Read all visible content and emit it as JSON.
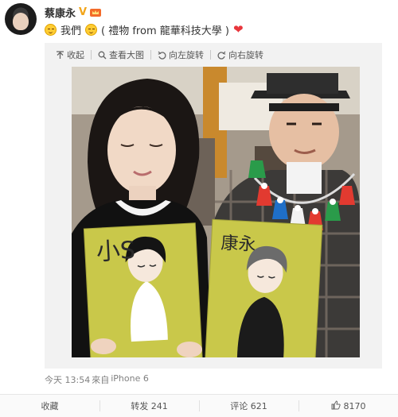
{
  "post": {
    "author": "蔡康永",
    "verified_badge": "V",
    "text_main": "我們",
    "text_note": "( 禮物 from 龍華科技大學 )",
    "time": "今天 13:54",
    "source_prefix": "來自",
    "source_device": "iPhone 6"
  },
  "media_toolbar": {
    "collapse": "收起",
    "view_large": "查看大图",
    "rotate_left": "向左旋转",
    "rotate_right": "向右旋转"
  },
  "photo": {
    "left_card_text": "小S",
    "right_card_text": "康永"
  },
  "actions": {
    "favorite": "收藏",
    "repost": "转发 241",
    "comment": "评论 621",
    "like_count": "8170"
  },
  "colors": {
    "verified": "#f2a51a",
    "heart": "#e8363c",
    "card_background": "#c9c84a"
  }
}
